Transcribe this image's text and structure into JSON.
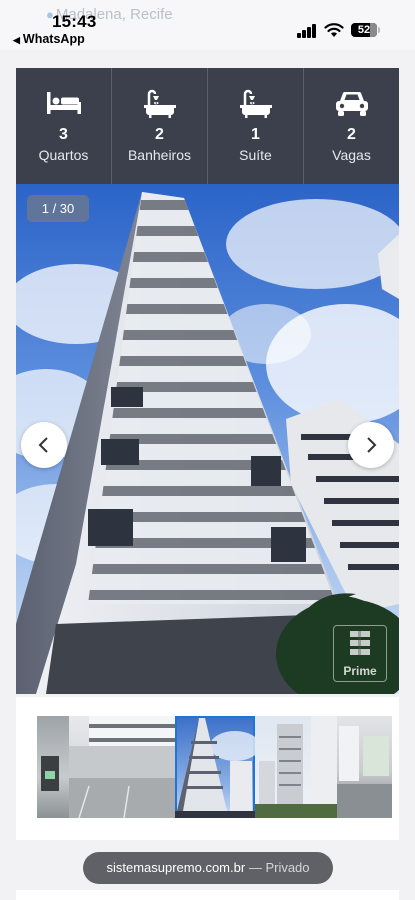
{
  "status_bar": {
    "time": "15:43",
    "back_app": "WhatsApp",
    "battery": "52",
    "location_text": "Madalena, Recife"
  },
  "features": [
    {
      "icon": "bed-icon",
      "value": "3",
      "label": "Quartos"
    },
    {
      "icon": "bathtub-icon",
      "value": "2",
      "label": "Banheiros"
    },
    {
      "icon": "bathtub-icon",
      "value": "1",
      "label": "Suíte"
    },
    {
      "icon": "car-icon",
      "value": "2",
      "label": "Vagas"
    }
  ],
  "gallery": {
    "counter": "1 / 30",
    "watermark": "Prime"
  },
  "thumbnails": [
    {
      "name": "garage-thumbnail"
    },
    {
      "name": "building-side-thumbnail"
    },
    {
      "name": "tower-thumbnail",
      "active": true
    },
    {
      "name": "towers-thumbnail"
    },
    {
      "name": "interior-thumbnail"
    }
  ],
  "url_bar": {
    "domain": "sistemasupremo.com.br",
    "separator": "—",
    "mode": "Privado"
  }
}
